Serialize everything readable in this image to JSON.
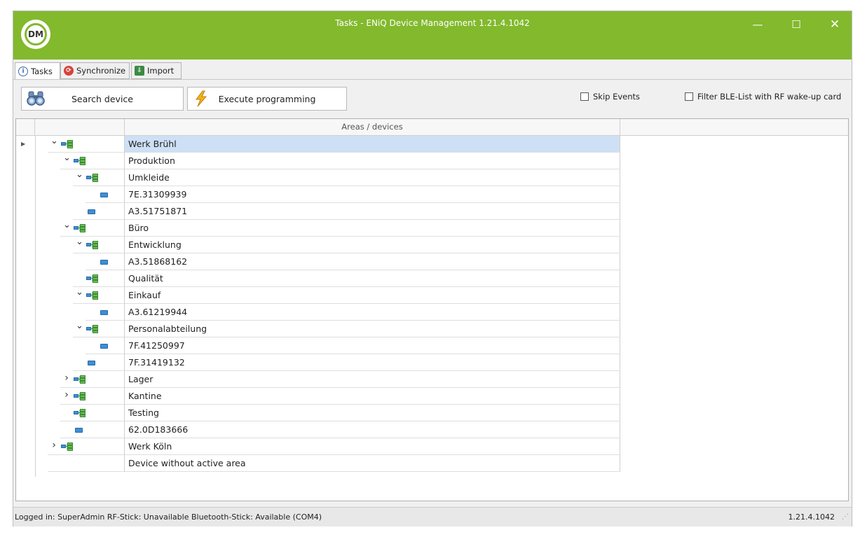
{
  "window": {
    "logo_text": "DM",
    "title": "Tasks - ENiQ Device Management 1.21.4.1042",
    "controls": {
      "minimize": "—",
      "maximize": "☐",
      "close": "✕"
    }
  },
  "tabs": [
    {
      "label": "Tasks",
      "active": true
    },
    {
      "label": "Synchronize",
      "active": false
    },
    {
      "label": "Import",
      "active": false
    }
  ],
  "toolbar": {
    "search_label": "Search device",
    "execute_label": "Execute programming",
    "skip_events_label": "Skip Events",
    "filter_ble_label": "Filter BLE-List with RF wake-up card"
  },
  "grid": {
    "column_header": "Areas / devices",
    "rows": [
      {
        "label": "Werk Brühl",
        "type": "area",
        "level": 0,
        "toggle": "expanded",
        "selected": true
      },
      {
        "label": "Produktion",
        "type": "area",
        "level": 1,
        "toggle": "expanded"
      },
      {
        "label": "Umkleide",
        "type": "area",
        "level": 2,
        "toggle": "expanded"
      },
      {
        "label": "7E.31309939",
        "type": "device",
        "level": 3
      },
      {
        "label": "A3.51751871",
        "type": "device",
        "level": 2
      },
      {
        "label": "Büro",
        "type": "area",
        "level": 1,
        "toggle": "expanded"
      },
      {
        "label": "Entwicklung",
        "type": "area",
        "level": 2,
        "toggle": "expanded"
      },
      {
        "label": "A3.51868162",
        "type": "device",
        "level": 3
      },
      {
        "label": "Qualität",
        "type": "area",
        "level": 2
      },
      {
        "label": "Einkauf",
        "type": "area",
        "level": 2,
        "toggle": "expanded"
      },
      {
        "label": "A3.61219944",
        "type": "device",
        "level": 3
      },
      {
        "label": "Personalabteilung",
        "type": "area",
        "level": 2,
        "toggle": "expanded"
      },
      {
        "label": "7F.41250997",
        "type": "device",
        "level": 3
      },
      {
        "label": "7F.31419132",
        "type": "device",
        "level": 2
      },
      {
        "label": "Lager",
        "type": "area",
        "level": 1,
        "toggle": "collapsed"
      },
      {
        "label": "Kantine",
        "type": "area",
        "level": 1,
        "toggle": "collapsed"
      },
      {
        "label": "Testing",
        "type": "area",
        "level": 1
      },
      {
        "label": "62.0D183666",
        "type": "device",
        "level": 1
      },
      {
        "label": "Werk Köln",
        "type": "area",
        "level": 0,
        "toggle": "collapsed"
      },
      {
        "label": "Device without active area",
        "type": "none",
        "level": 0
      }
    ]
  },
  "status": {
    "text": "Logged in: SuperAdmin  RF-Stick: Unavailable  Bluetooth-Stick: Available (COM4)",
    "version": "1.21.4.1042"
  }
}
